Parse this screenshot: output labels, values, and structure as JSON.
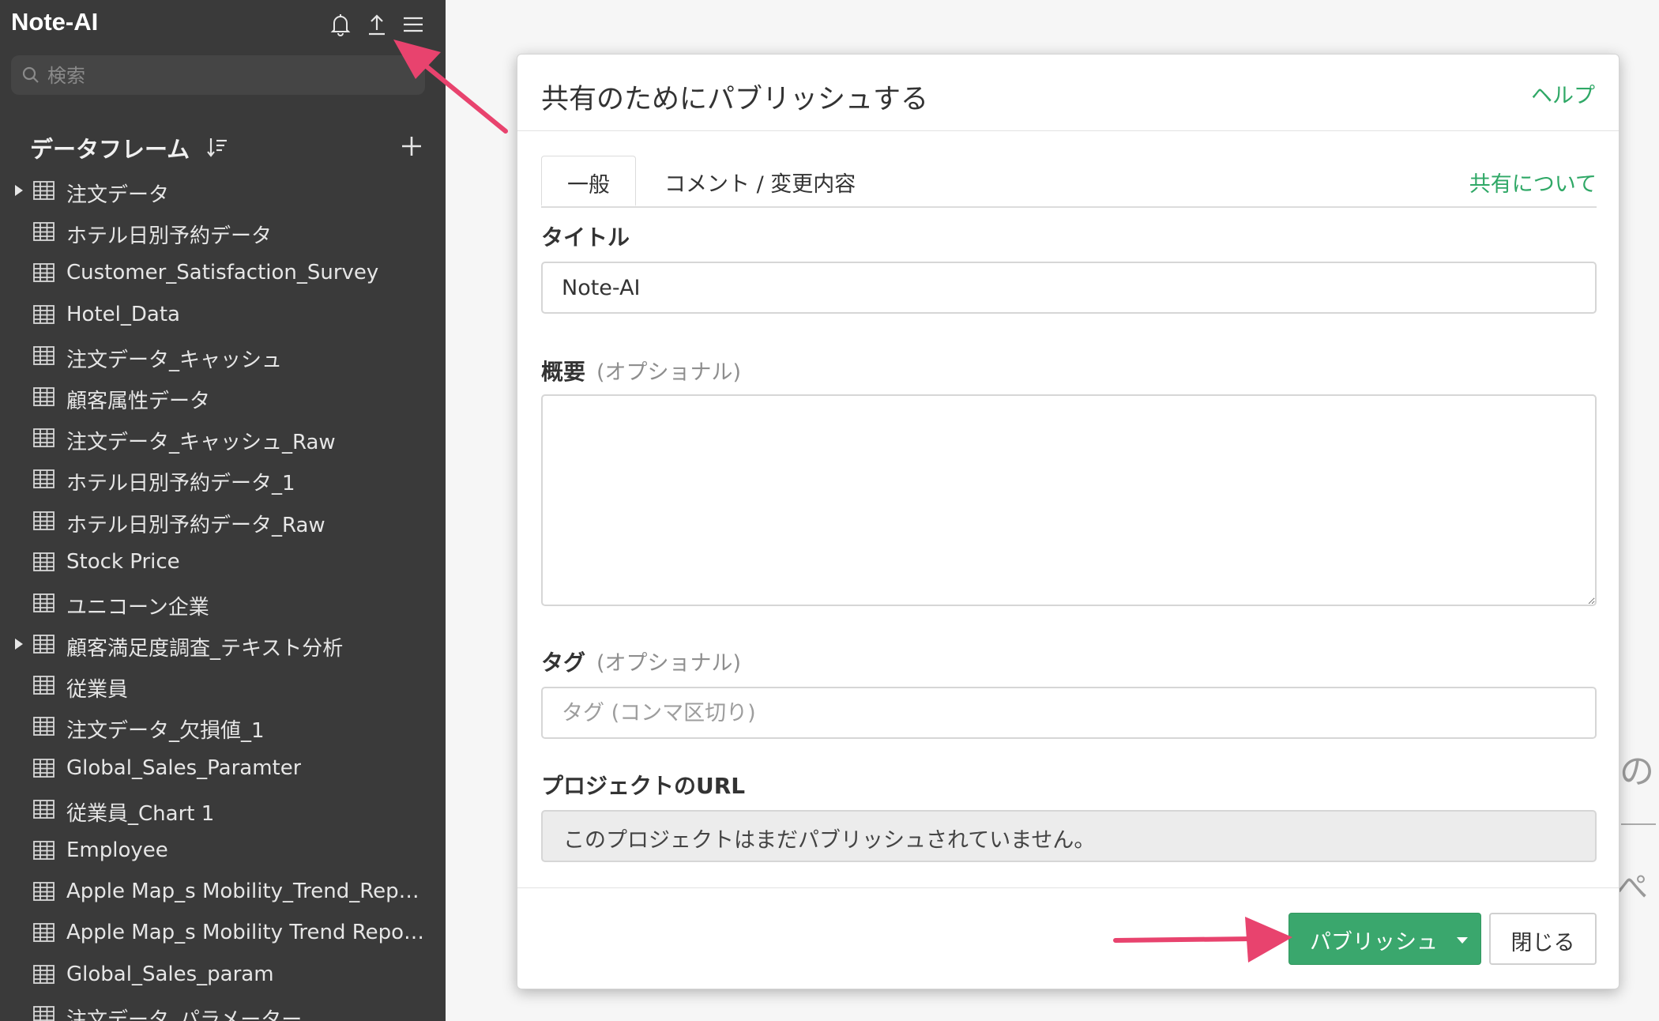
{
  "sidebar": {
    "app_title": "Note-AI",
    "icons": [
      "bell-icon",
      "upload-icon",
      "menu-icon"
    ],
    "search_placeholder": "検索",
    "dataframes_title": "データフレーム",
    "items": [
      {
        "label": "注文データ",
        "expandable": true
      },
      {
        "label": "ホテル日別予約データ",
        "expandable": false
      },
      {
        "label": "Customer_Satisfaction_Survey",
        "expandable": false
      },
      {
        "label": "Hotel_Data",
        "expandable": false
      },
      {
        "label": "注文データ_キャッシュ",
        "expandable": false
      },
      {
        "label": "顧客属性データ",
        "expandable": false
      },
      {
        "label": "注文データ_キャッシュ_Raw",
        "expandable": false
      },
      {
        "label": "ホテル日別予約データ_1",
        "expandable": false
      },
      {
        "label": "ホテル日別予約データ_Raw",
        "expandable": false
      },
      {
        "label": "Stock Price",
        "expandable": false
      },
      {
        "label": "ユニコーン企業",
        "expandable": false
      },
      {
        "label": "顧客満足度調査_テキスト分析",
        "expandable": true
      },
      {
        "label": "従業員",
        "expandable": false
      },
      {
        "label": "注文データ_欠損値_1",
        "expandable": false
      },
      {
        "label": "Global_Sales_Paramter",
        "expandable": false
      },
      {
        "label": "従業員_Chart 1",
        "expandable": false
      },
      {
        "label": "Employee",
        "expandable": false
      },
      {
        "label": "Apple Map_s Mobility_Trend_Report…",
        "expandable": false
      },
      {
        "label": "Apple Map_s Mobility Trend Report …",
        "expandable": false
      },
      {
        "label": "Global_Sales_param",
        "expandable": false
      },
      {
        "label": "注文データ_パラメーター",
        "expandable": false
      }
    ]
  },
  "background": {
    "peek_glyph_1": "の",
    "peek_glyph_3": "ぺ"
  },
  "modal": {
    "title": "共有のためにパブリッシュする",
    "help_link": "ヘルプ",
    "tabs": [
      {
        "label": "一般",
        "active": true
      },
      {
        "label": "コメント / 変更内容",
        "active": false
      }
    ],
    "about_link": "共有について",
    "title_field": {
      "label": "タイトル",
      "value": "Note-AI"
    },
    "summary_field": {
      "label": "概要",
      "optional": "(オプショナル)",
      "value": ""
    },
    "tags_field": {
      "label": "タグ",
      "optional": "(オプショナル)",
      "placeholder": "タグ (コンマ区切り)"
    },
    "url_field": {
      "label": "プロジェクトのURL",
      "value": "このプロジェクトはまだパブリッシュされていません。"
    },
    "publish_button": "パブリッシュ",
    "close_button": "閉じる"
  },
  "colors": {
    "sidebar_bg": "#3a3a3a",
    "accent_green": "#3aa76d",
    "link_green": "#2fa866",
    "arrow_pink": "#e8436e"
  }
}
